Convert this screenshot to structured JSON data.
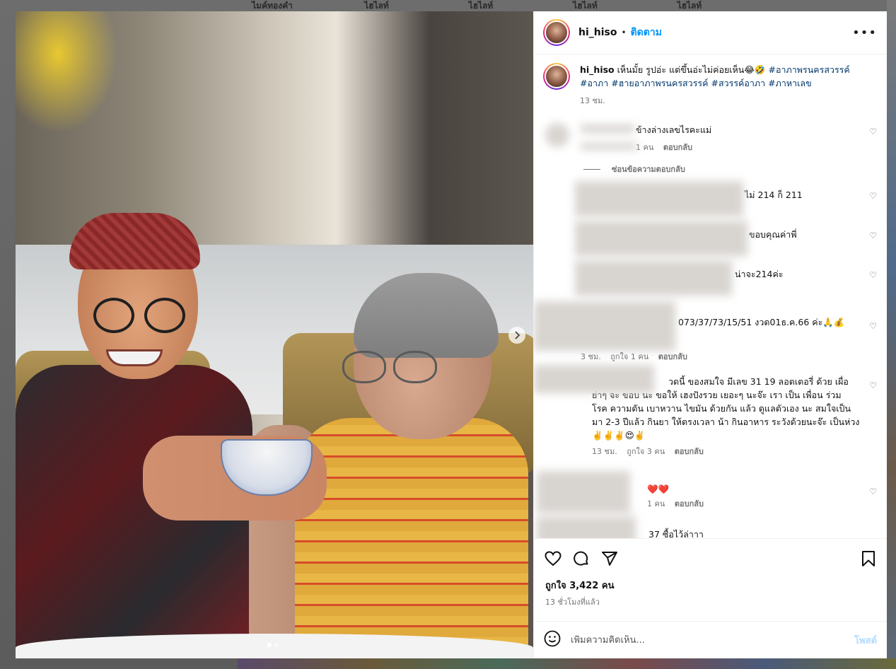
{
  "background": {
    "tabs": [
      "ไมค์ทองคำ",
      "ไฮไลท์",
      "ไฮไลท์",
      "ไฮไลท์",
      "ไฮไลท์"
    ]
  },
  "post": {
    "username": "hi_hiso",
    "separator": "•",
    "follow_label": "ติดตาม",
    "more_label": "•••",
    "caption": {
      "username": "hi_hiso",
      "text": " เห็นมั้ย รูปอ่ะ แต่ขึ้นอ่ะไม่ค่อยเห็น😂🤣 ",
      "tags": [
        "#อาภาพรนครสวรรค์",
        "#อาภา",
        "#ฮายอาภาพรนครสวรรค์",
        "#สวรรค์อาภา",
        "#ภาหาเลข"
      ],
      "time": "13 ชม."
    },
    "comments": [
      {
        "text": "ข้างล่างเลขไรคะแม่",
        "meta_likes": "1 คน",
        "meta_reply": "ตอบกลับ"
      },
      {
        "hide_replies": "ซ่อนข้อความตอบกลับ"
      },
      {
        "text": "ไม่ 214 ก็ 211"
      },
      {
        "text": "ขอบคุณค่าพี่"
      },
      {
        "text": "น่าจะ214ค่ะ"
      },
      {
        "text": "073/37/73/15/51 งวด01ธ.ค.66 ค่ะ🙏💰",
        "meta_time": "3 ชม.",
        "meta_likes": "ถูกใจ 1 คน",
        "meta_reply": "ตอบกลับ"
      },
      {
        "text_lines": [
          "วดนี้ ของสมใจ มีเลข 31 19 ลอตเตอรี่ ด้วย เผื่อ",
          "ย่าๆ จะ ขอบ นะ ขอให้ เฮงปังรวย เยอะๆ นะจ๊ะ เรา เป็น เพื่อน ร่วม",
          "โรค ความดัน เบาหวาน ไขมัน ด้วยกัน แล้ว ดูแลตัวเอง นะ สมใจเป็น",
          "มา 2-3 ปีแล้ว กินยา ให้ตรงเวลา น้า กินอาหาร ระวังด้วยนะจ๊ะ เป็นห่วง",
          "✌️✌️✌️😍✌️"
        ],
        "meta_time": "13 ชม.",
        "meta_likes": "ถูกใจ 3 คน",
        "meta_reply": "ตอบกลับ"
      },
      {
        "text": "❤️❤️",
        "meta_likes": "1 คน",
        "meta_reply": "ตอบกลับ"
      },
      {
        "text": "37 ซื้อไว้ล่าาา"
      }
    ],
    "likes": "ถูกใจ 3,422 คน",
    "time_ago": "13 ชั่วโมงที่แล้ว",
    "add_comment_placeholder": "เพิ่มความคิดเห็น...",
    "post_label": "โพสต์"
  }
}
